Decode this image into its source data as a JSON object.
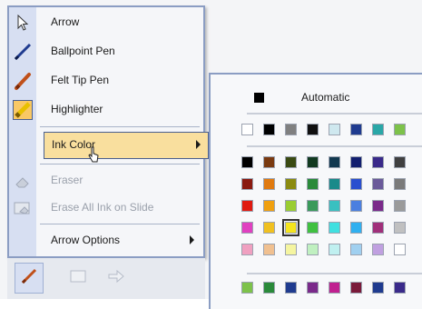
{
  "menu": {
    "items": [
      {
        "label": "Arrow",
        "icon": "arrow-pointer-icon",
        "disabled": false
      },
      {
        "label": "Ballpoint Pen",
        "icon": "ballpoint-pen-icon",
        "disabled": false
      },
      {
        "label": "Felt Tip Pen",
        "icon": "felt-tip-pen-icon",
        "disabled": false
      },
      {
        "label": "Highlighter",
        "icon": "highlighter-icon",
        "disabled": false,
        "checked": true
      },
      {
        "label": "Ink Color",
        "submenu": true,
        "hover": true
      },
      {
        "label": "Eraser",
        "icon": "eraser-icon",
        "disabled": true
      },
      {
        "label": "Erase All Ink on Slide",
        "icon": "erase-all-icon",
        "disabled": true
      },
      {
        "label": "Arrow Options",
        "submenu": true
      }
    ]
  },
  "toolbar": {
    "buttons": [
      "pen-icon",
      "slide-menu-icon",
      "next-arrow-icon"
    ]
  },
  "palette": {
    "automatic_label": "Automatic",
    "standard_row": [
      "#ffffff",
      "#000000",
      "#808080",
      "#101010",
      "#cfe8ef",
      "#1f3b8f",
      "#2aa7a7",
      "#7dc24a"
    ],
    "grid_rows": [
      [
        "#000000",
        "#7a3a10",
        "#3a4a12",
        "#123a20",
        "#12384f",
        "#121f6f",
        "#3a2a8a",
        "#404040"
      ],
      [
        "#8a1a10",
        "#e07a10",
        "#8a8a10",
        "#2a8a3a",
        "#1a8a8a",
        "#2a4fcf",
        "#6a5a9a",
        "#7a7a7a"
      ],
      [
        "#e01a10",
        "#f0a010",
        "#9acd32",
        "#3a9a5a",
        "#3ac0c0",
        "#4a7fe0",
        "#7a2a8a",
        "#9a9a9a"
      ],
      [
        "#e040c0",
        "#f0c020",
        "#f5e51e",
        "#40c040",
        "#40e0e0",
        "#30b0f0",
        "#a0307a",
        "#c0c0c0"
      ],
      [
        "#f0a0c0",
        "#f0c090",
        "#f5f5a0",
        "#c0f0c0",
        "#c0f0f0",
        "#a0d0f0",
        "#c0a0e0",
        "#ffffff"
      ]
    ],
    "selected": {
      "row": 3,
      "col": 2
    },
    "bottom_row": [
      "#7dc24a",
      "#2a8a3a",
      "#1f3b8f",
      "#7a2a8a",
      "#c02090",
      "#7a1a3a",
      "#1f3b8f",
      "#3a2a8a"
    ]
  }
}
